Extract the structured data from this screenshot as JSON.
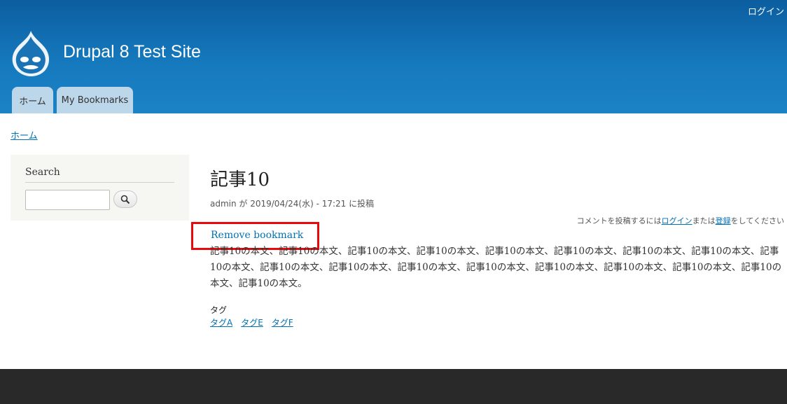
{
  "header": {
    "login_link": "ログイン",
    "site_name": "Drupal 8 Test Site",
    "tabs": [
      {
        "label": "ホーム"
      },
      {
        "label": "My Bookmarks"
      }
    ]
  },
  "breadcrumb": {
    "home": "ホーム"
  },
  "sidebar": {
    "search_title": "Search",
    "search_value": ""
  },
  "article": {
    "title": "記事10",
    "submitted": "admin が 2019/04/24(水) - 17:21 に投稿",
    "comment_note": {
      "prefix": "コメントを投稿するには",
      "login": "ログイン",
      "middle": "または",
      "register": "登録",
      "suffix": "をしてください"
    },
    "remove_bookmark": "Remove bookmark",
    "body": "記事10の本文、記事10の本文、記事10の本文、記事10の本文、記事10の本文、記事10の本文、記事10の本文、記事10の本文、記事10の本文、記事10の本文、記事10の本文、記事10の本文、記事10の本文、記事10の本文、記事10の本文、記事10の本文、記事10の本文、記事10の本文。",
    "tag_label": "タグ",
    "tags": [
      "タグA",
      "タグE",
      "タグF"
    ]
  },
  "colors": {
    "header_blue": "#1679bd",
    "link": "#0071b3",
    "highlight": "#e8090b",
    "footer": "#292929"
  }
}
